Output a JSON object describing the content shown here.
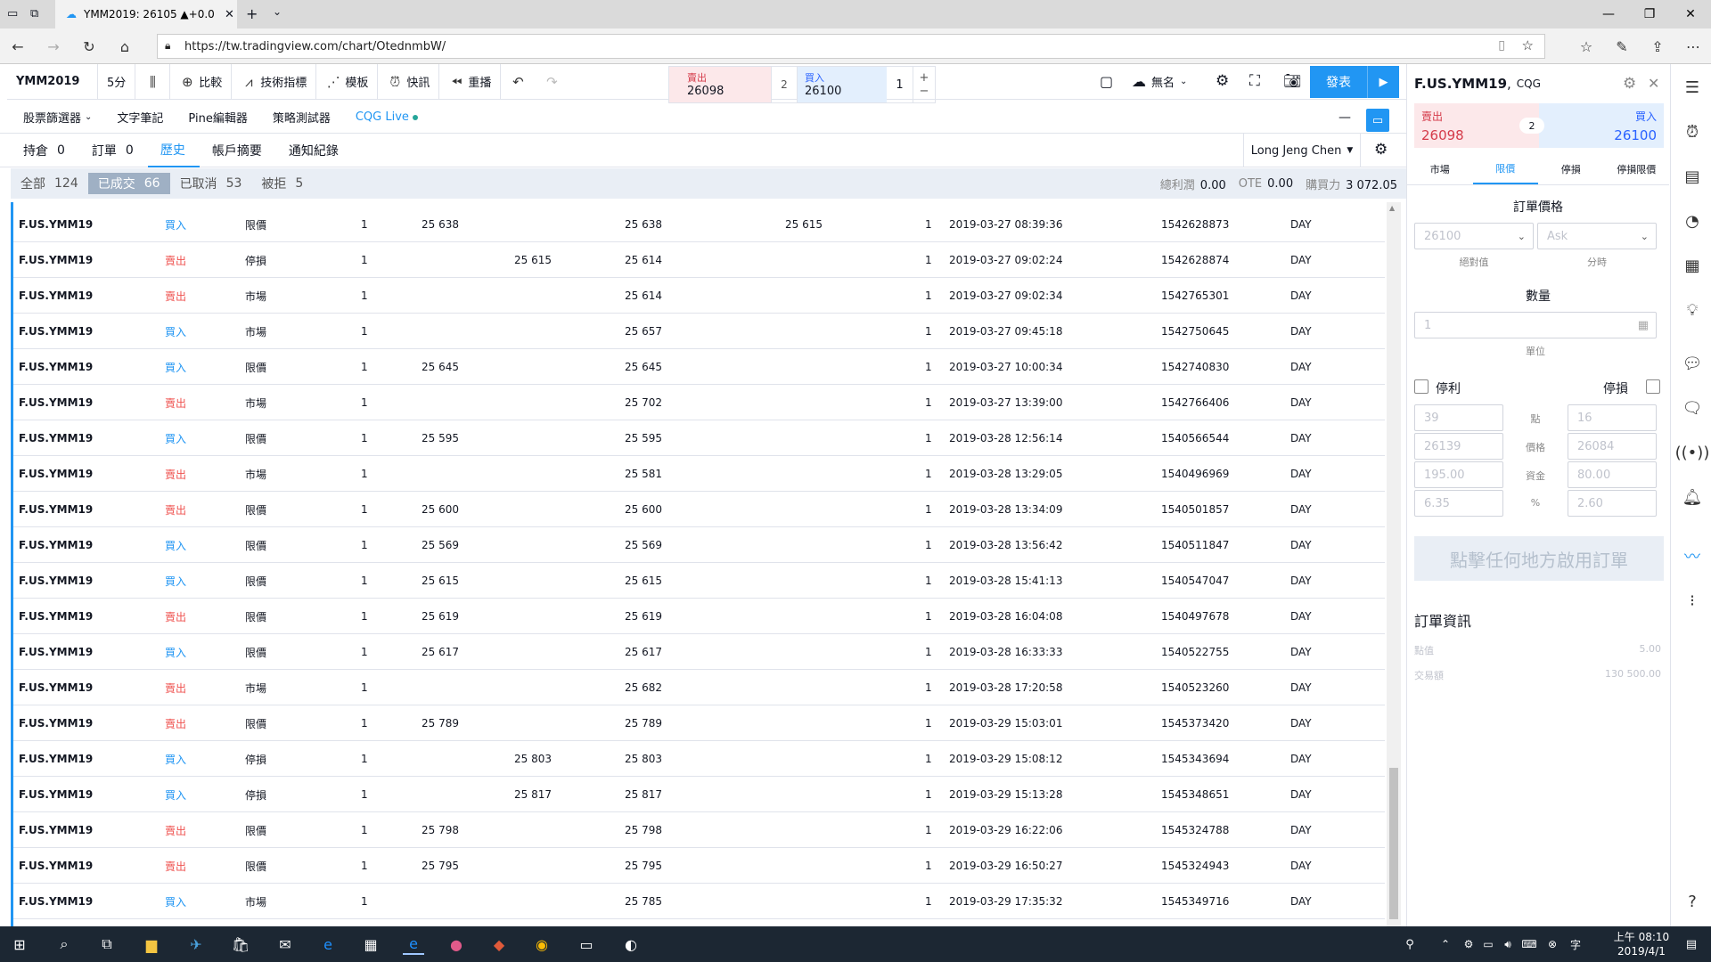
{
  "browser": {
    "tab_title": "YMM2019: 26105 ▲+0.0",
    "url": "https://tw.tradingview.com/chart/OtednmbW/"
  },
  "toolbar": {
    "symbol": "YMM2019",
    "interval": "5分",
    "compare": "比較",
    "indicators": "技術指標",
    "templates": "模板",
    "alerts": "快訊",
    "replay": "重播",
    "cloud_name": "無名",
    "publish": "發表"
  },
  "quick_trade": {
    "sell_label": "賣出",
    "sell_price": "26098",
    "spread": "2",
    "buy_label": "買入",
    "buy_price": "26100",
    "qty": "1",
    "plus": "+",
    "minus": "−"
  },
  "panel_tabs": [
    {
      "label": "股票篩選器"
    },
    {
      "label": "文字筆記"
    },
    {
      "label": "Pine編輯器"
    },
    {
      "label": "策略測試器"
    },
    {
      "label": "CQG Live"
    }
  ],
  "sub_tabs": [
    {
      "label": "持倉",
      "count": "0"
    },
    {
      "label": "訂單",
      "count": "0"
    },
    {
      "label": "歷史",
      "count": ""
    },
    {
      "label": "帳戶摘要",
      "count": ""
    },
    {
      "label": "通知紀錄",
      "count": ""
    }
  ],
  "account_name": "Long Jeng Chen",
  "filters": [
    {
      "label": "全部",
      "count": "124"
    },
    {
      "label": "已成交",
      "count": "66"
    },
    {
      "label": "已取消",
      "count": "53"
    },
    {
      "label": "被拒",
      "count": "5"
    }
  ],
  "summary": {
    "pnl_label": "總利潤",
    "pnl_value": "0.00",
    "ote_label": "OTE",
    "ote_value": "0.00",
    "bp_label": "購買力",
    "bp_value": "3 072.05"
  },
  "rows": [
    {
      "symbol": "F.US.YMM19",
      "side": "買入",
      "type": "限價",
      "qty": "1",
      "limit": "25 638",
      "stop": "",
      "avg": "25 638",
      "extra": "25 615",
      "filled": "1",
      "time": "2019-03-27 08:39:36",
      "id": "1542628873",
      "tif": "DAY"
    },
    {
      "symbol": "F.US.YMM19",
      "side": "賣出",
      "type": "停損",
      "qty": "1",
      "limit": "",
      "stop": "25 615",
      "avg": "25 614",
      "extra": "",
      "filled": "1",
      "time": "2019-03-27 09:02:24",
      "id": "1542628874",
      "tif": "DAY"
    },
    {
      "symbol": "F.US.YMM19",
      "side": "賣出",
      "type": "市場",
      "qty": "1",
      "limit": "",
      "stop": "",
      "avg": "25 614",
      "extra": "",
      "filled": "1",
      "time": "2019-03-27 09:02:34",
      "id": "1542765301",
      "tif": "DAY"
    },
    {
      "symbol": "F.US.YMM19",
      "side": "買入",
      "type": "市場",
      "qty": "1",
      "limit": "",
      "stop": "",
      "avg": "25 657",
      "extra": "",
      "filled": "1",
      "time": "2019-03-27 09:45:18",
      "id": "1542750645",
      "tif": "DAY"
    },
    {
      "symbol": "F.US.YMM19",
      "side": "買入",
      "type": "限價",
      "qty": "1",
      "limit": "25 645",
      "stop": "",
      "avg": "25 645",
      "extra": "",
      "filled": "1",
      "time": "2019-03-27 10:00:34",
      "id": "1542740830",
      "tif": "DAY"
    },
    {
      "symbol": "F.US.YMM19",
      "side": "賣出",
      "type": "市場",
      "qty": "1",
      "limit": "",
      "stop": "",
      "avg": "25 702",
      "extra": "",
      "filled": "1",
      "time": "2019-03-27 13:39:00",
      "id": "1542766406",
      "tif": "DAY"
    },
    {
      "symbol": "F.US.YMM19",
      "side": "買入",
      "type": "限價",
      "qty": "1",
      "limit": "25 595",
      "stop": "",
      "avg": "25 595",
      "extra": "",
      "filled": "1",
      "time": "2019-03-28 12:56:14",
      "id": "1540566544",
      "tif": "DAY"
    },
    {
      "symbol": "F.US.YMM19",
      "side": "賣出",
      "type": "市場",
      "qty": "1",
      "limit": "",
      "stop": "",
      "avg": "25 581",
      "extra": "",
      "filled": "1",
      "time": "2019-03-28 13:29:05",
      "id": "1540496969",
      "tif": "DAY"
    },
    {
      "symbol": "F.US.YMM19",
      "side": "賣出",
      "type": "限價",
      "qty": "1",
      "limit": "25 600",
      "stop": "",
      "avg": "25 600",
      "extra": "",
      "filled": "1",
      "time": "2019-03-28 13:34:09",
      "id": "1540501857",
      "tif": "DAY"
    },
    {
      "symbol": "F.US.YMM19",
      "side": "買入",
      "type": "限價",
      "qty": "1",
      "limit": "25 569",
      "stop": "",
      "avg": "25 569",
      "extra": "",
      "filled": "1",
      "time": "2019-03-28 13:56:42",
      "id": "1540511847",
      "tif": "DAY"
    },
    {
      "symbol": "F.US.YMM19",
      "side": "買入",
      "type": "限價",
      "qty": "1",
      "limit": "25 615",
      "stop": "",
      "avg": "25 615",
      "extra": "",
      "filled": "1",
      "time": "2019-03-28 15:41:13",
      "id": "1540547047",
      "tif": "DAY"
    },
    {
      "symbol": "F.US.YMM19",
      "side": "賣出",
      "type": "限價",
      "qty": "1",
      "limit": "25 619",
      "stop": "",
      "avg": "25 619",
      "extra": "",
      "filled": "1",
      "time": "2019-03-28 16:04:08",
      "id": "1540497678",
      "tif": "DAY"
    },
    {
      "symbol": "F.US.YMM19",
      "side": "買入",
      "type": "限價",
      "qty": "1",
      "limit": "25 617",
      "stop": "",
      "avg": "25 617",
      "extra": "",
      "filled": "1",
      "time": "2019-03-28 16:33:33",
      "id": "1540522755",
      "tif": "DAY"
    },
    {
      "symbol": "F.US.YMM19",
      "side": "賣出",
      "type": "市場",
      "qty": "1",
      "limit": "",
      "stop": "",
      "avg": "25 682",
      "extra": "",
      "filled": "1",
      "time": "2019-03-28 17:20:58",
      "id": "1540523260",
      "tif": "DAY"
    },
    {
      "symbol": "F.US.YMM19",
      "side": "賣出",
      "type": "限價",
      "qty": "1",
      "limit": "25 789",
      "stop": "",
      "avg": "25 789",
      "extra": "",
      "filled": "1",
      "time": "2019-03-29 15:03:01",
      "id": "1545373420",
      "tif": "DAY"
    },
    {
      "symbol": "F.US.YMM19",
      "side": "買入",
      "type": "停損",
      "qty": "1",
      "limit": "",
      "stop": "25 803",
      "avg": "25 803",
      "extra": "",
      "filled": "1",
      "time": "2019-03-29 15:08:12",
      "id": "1545343694",
      "tif": "DAY"
    },
    {
      "symbol": "F.US.YMM19",
      "side": "買入",
      "type": "停損",
      "qty": "1",
      "limit": "",
      "stop": "25 817",
      "avg": "25 817",
      "extra": "",
      "filled": "1",
      "time": "2019-03-29 15:13:28",
      "id": "1545348651",
      "tif": "DAY"
    },
    {
      "symbol": "F.US.YMM19",
      "side": "賣出",
      "type": "限價",
      "qty": "1",
      "limit": "25 798",
      "stop": "",
      "avg": "25 798",
      "extra": "",
      "filled": "1",
      "time": "2019-03-29 16:22:06",
      "id": "1545324788",
      "tif": "DAY"
    },
    {
      "symbol": "F.US.YMM19",
      "side": "賣出",
      "type": "限價",
      "qty": "1",
      "limit": "25 795",
      "stop": "",
      "avg": "25 795",
      "extra": "",
      "filled": "1",
      "time": "2019-03-29 16:50:27",
      "id": "1545324943",
      "tif": "DAY"
    },
    {
      "symbol": "F.US.YMM19",
      "side": "買入",
      "type": "市場",
      "qty": "1",
      "limit": "",
      "stop": "",
      "avg": "25 785",
      "extra": "",
      "filled": "1",
      "time": "2019-03-29 17:35:32",
      "id": "1545349716",
      "tif": "DAY"
    }
  ],
  "order_panel": {
    "symbol": "F.US.YMM19",
    "broker": "CQG",
    "sell_label": "賣出",
    "sell_price": "26098",
    "buy_label": "買入",
    "buy_price": "26100",
    "spread": "2",
    "tabs": [
      {
        "label": "市場"
      },
      {
        "label": "限價"
      },
      {
        "label": "停損"
      },
      {
        "label": "停損限價"
      }
    ],
    "price_title": "訂單價格",
    "price_value": "26100",
    "price_mode": "Ask",
    "abs_label": "絕對值",
    "tick_label": "分時",
    "qty_title": "數量",
    "qty_value": "1",
    "unit_label": "單位",
    "tp_label": "停利",
    "sl_label": "停損",
    "tp_values": [
      "39",
      "26139",
      "195.00",
      "6.35"
    ],
    "sl_values": [
      "16",
      "26084",
      "80.00",
      "2.60"
    ],
    "mid_labels": [
      "點",
      "價格",
      "資金",
      "%"
    ],
    "place_label": "點擊任何地方啟用訂單",
    "info_title": "訂單資訊",
    "info_rows": [
      {
        "label": "點值",
        "value": "5.00"
      },
      {
        "label": "交易額",
        "value": "130 500.00"
      }
    ]
  },
  "clock": {
    "time": "上午 08:10",
    "date": "2019/4/1"
  },
  "colors": {
    "buy": "#2196f3",
    "sell": "#ef5350",
    "accent": "#2196f3"
  }
}
